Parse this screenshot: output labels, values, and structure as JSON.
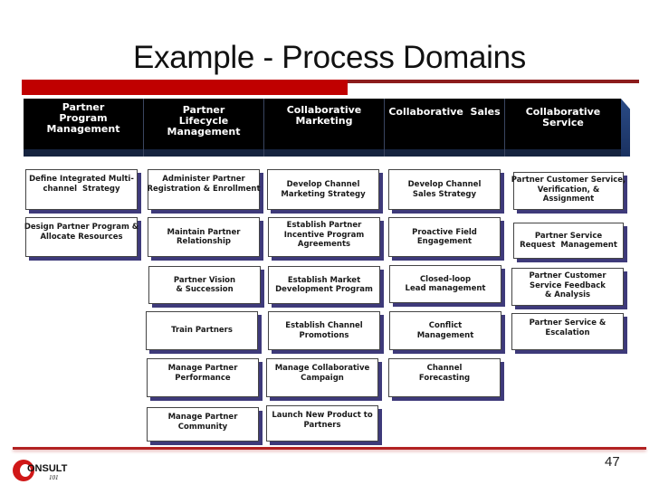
{
  "slide": {
    "title": "Example - Process Domains",
    "page_number": "47",
    "logo": {
      "text": "ONSULT",
      "sub": "101",
      "icon": "consult-c-icon"
    }
  },
  "colors": {
    "accent_red": "#c00000",
    "header_bg": "#000000",
    "box_shadow": "#3e3a7a"
  },
  "domains": [
    {
      "header": "Partner\nProgram\nManagement",
      "items": [
        "Define Integrated Multi-\nchannel  Strategy",
        "Design Partner Program &\nAllocate Resources"
      ]
    },
    {
      "header": "Partner\nLifecycle\nManagement",
      "items": [
        "Administer Partner\nRegistration & Enrollment",
        "Maintain Partner\nRelationship",
        "Partner Vision\n& Succession",
        "Train Partners",
        "Manage Partner\nPerformance",
        "Manage Partner\nCommunity"
      ]
    },
    {
      "header": "Collaborative\nMarketing",
      "items": [
        "Develop Channel\nMarketing Strategy",
        "Establish Partner\nIncentive Program\nAgreements",
        "Establish Market\nDevelopment Program",
        "Establish Channel\nPromotions",
        "Manage Collaborative\nCampaign",
        "Launch New Product to\nPartners"
      ]
    },
    {
      "header": "Collaborative  Sales",
      "items": [
        "Develop Channel\nSales Strategy",
        "Proactive Field\nEngagement",
        "Closed-loop\nLead management",
        "Conflict\nManagement",
        "Channel\nForecasting"
      ]
    },
    {
      "header": "Collaborative\nService",
      "items": [
        "Partner Customer Service,\nVerification, &\nAssignment",
        "Partner Service\nRequest  Management",
        "Partner Customer\nService Feedback\n& Analysis",
        "Partner Service &\nEscalation"
      ]
    }
  ]
}
